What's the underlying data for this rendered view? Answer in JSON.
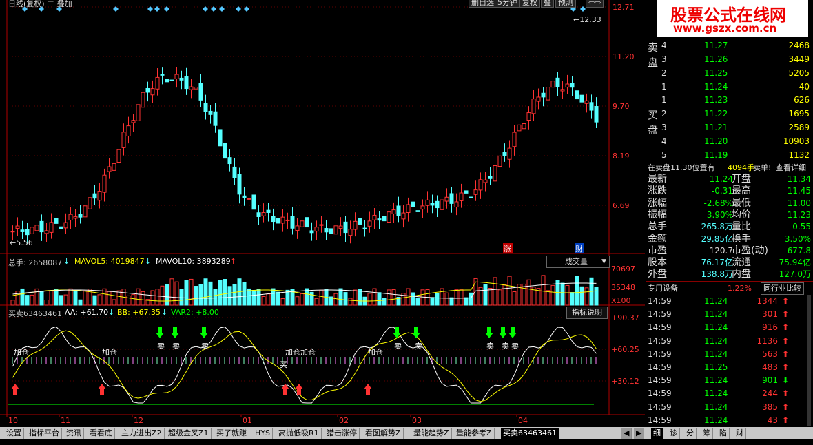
{
  "title_bar": {
    "left_text": "日线(复权)  二  叠加",
    "buttons": [
      "删自选",
      "5分钟",
      "复权",
      "叠",
      "预测"
    ]
  },
  "price_chart": {
    "axis_labels": [
      "12.71",
      "11.20",
      "9.70",
      "8.19",
      "6.69"
    ],
    "high_marker": "12.33",
    "low_marker": "5.56",
    "event_badges": [
      "涨",
      "财"
    ]
  },
  "volume_panel": {
    "header": {
      "total": "总手: 2658087",
      "mavol5": "MAVOL5: 4019847",
      "mavol10": "MAVOL10: 3893289"
    },
    "indicator_select": "成交量",
    "axis_labels": [
      "70697",
      "35348",
      "X100"
    ]
  },
  "indicator_panel": {
    "header": {
      "name": "买卖63463461",
      "aa": "AA: +61.70",
      "bb": "BB: +67.35",
      "var2": "VAR2: +8.00"
    },
    "explain_button": "指标说明",
    "axis_labels": [
      "+90.37",
      "+60.25",
      "+30.12"
    ],
    "signal_labels": [
      "加仓",
      "加仓",
      "加仓",
      "加仓",
      "加仓",
      "卖",
      "卖",
      "卖",
      "卖",
      "卖",
      "卖",
      "卖",
      "卖",
      "买"
    ]
  },
  "x_axis": {
    "labels": [
      "10",
      "11",
      "12",
      "01",
      "02",
      "03",
      "04"
    ]
  },
  "orderbook": {
    "sell_label": "卖盘",
    "buy_label": "买盘",
    "sell": [
      {
        "level": "4",
        "price": "11.27",
        "vol": "2468"
      },
      {
        "level": "3",
        "price": "11.26",
        "vol": "3449"
      },
      {
        "level": "2",
        "price": "11.25",
        "vol": "5205"
      },
      {
        "level": "1",
        "price": "11.24",
        "vol": "40"
      }
    ],
    "buy": [
      {
        "level": "1",
        "price": "11.23",
        "vol": "626"
      },
      {
        "level": "2",
        "price": "11.22",
        "vol": "1695"
      },
      {
        "level": "3",
        "price": "11.21",
        "vol": "2589"
      },
      {
        "level": "4",
        "price": "11.20",
        "vol": "10903"
      },
      {
        "level": "5",
        "price": "11.19",
        "vol": "1132"
      }
    ],
    "notice": {
      "text": "在卖盘11.30位置有",
      "vol": "4094手",
      "action": "卖单!",
      "link": "查看详细"
    }
  },
  "quote": [
    {
      "l1": "最新",
      "v1": "11.24",
      "l2": "开盘",
      "v2": "11.34"
    },
    {
      "l1": "涨跌",
      "v1": "-0.31",
      "l2": "最高",
      "v2": "11.45"
    },
    {
      "l1": "涨幅",
      "v1": "-2.68%",
      "l2": "最低",
      "v2": "11.00"
    },
    {
      "l1": "振幅",
      "v1": "3.90%",
      "l2": "均价",
      "v2": "11.23"
    },
    {
      "l1": "总手",
      "v1": "265.8万",
      "l2": "量比",
      "v2": "0.55"
    },
    {
      "l1": "金额",
      "v1": "29.85亿",
      "l2": "换手",
      "v2": "3.50%"
    },
    {
      "l1": "市盈",
      "v1": "120.7",
      "l2": "市盈(动)",
      "v2": "677.8"
    },
    {
      "l1": "股本",
      "v1": "76.17亿",
      "l2": "流通",
      "v2": "75.94亿"
    },
    {
      "l1": "外盘",
      "v1": "138.8万",
      "l2": "内盘",
      "v2": "127.0万"
    }
  ],
  "compare_bar": {
    "left": "专用设备",
    "pct": "1.22%",
    "button": "同行业比较"
  },
  "ticks": [
    {
      "time": "14:59",
      "price": "11.24",
      "vol": "1344",
      "dir": "up"
    },
    {
      "time": "14:59",
      "price": "11.24",
      "vol": "301",
      "dir": "up"
    },
    {
      "time": "14:59",
      "price": "11.24",
      "vol": "916",
      "dir": "up"
    },
    {
      "time": "14:59",
      "price": "11.24",
      "vol": "1136",
      "dir": "up"
    },
    {
      "time": "14:59",
      "price": "11.24",
      "vol": "563",
      "dir": "up"
    },
    {
      "time": "14:59",
      "price": "11.25",
      "vol": "483",
      "dir": "up"
    },
    {
      "time": "14:59",
      "price": "11.24",
      "vol": "901",
      "dir": "down"
    },
    {
      "time": "14:59",
      "price": "11.24",
      "vol": "244",
      "dir": "up"
    },
    {
      "time": "14:59",
      "price": "11.24",
      "vol": "385",
      "dir": "up"
    },
    {
      "time": "14:59",
      "price": "11.24",
      "vol": "43",
      "dir": "up"
    }
  ],
  "bottom_tabs": [
    "设置",
    "指标平台",
    "资讯",
    "看看底",
    "主力进出Z2",
    "超级金叉Z1",
    "买了就赚",
    "HYS",
    "高抛低吸R1",
    "猎击涨停",
    "看图解势Z",
    "量能趋势Z",
    "量能参考Z",
    "买卖63463461"
  ],
  "right_tabs": [
    "细",
    "诊",
    "分",
    "筹",
    "陷",
    "财"
  ],
  "logo": {
    "line1": "股票公式在线网",
    "line2": "www.gszx.com.cn"
  },
  "colors": {
    "up": "#ff3232",
    "down": "#54ffff",
    "green": "#00ff00",
    "yellow": "#ffff00",
    "accent": "#ff0000"
  }
}
